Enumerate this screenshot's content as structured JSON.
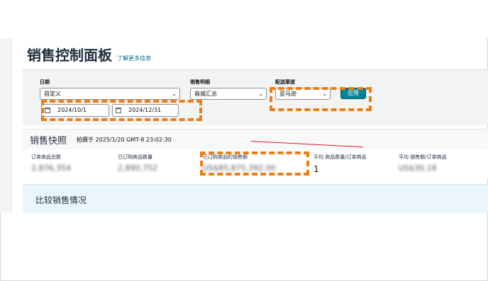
{
  "header": {
    "title": "销售控制面板",
    "learn_more": "了解更多信息"
  },
  "filters": {
    "date": {
      "label": "日期",
      "range_value": "自定义",
      "start": "2024/10/1",
      "end": "2024/12/31"
    },
    "breakdown": {
      "label": "销售明细",
      "value": "商城汇总"
    },
    "channel": {
      "label": "配送渠道",
      "value": "亚马逊"
    },
    "apply_label": "应用"
  },
  "snapshot": {
    "title": "销售快照",
    "taken_at": "拍摄于 2025/1/20 GMT-8 23:02:30",
    "metrics": [
      {
        "label": "订单商品总数",
        "value": "2,876,354"
      },
      {
        "label": "已订购商品数量",
        "value": "2,890,752"
      },
      {
        "label": "已订购商品的销售额",
        "value": "US$85,875,392.00"
      },
      {
        "label": "平均 商品数量/订单商品",
        "value": "1"
      },
      {
        "label": "平均 销售额/订单商品",
        "value": "US$30.18"
      }
    ]
  },
  "compare": {
    "title": "比较销售情况"
  },
  "colors": {
    "accent": "#008296",
    "annotation": "#ee7d12",
    "link": "#007185"
  }
}
